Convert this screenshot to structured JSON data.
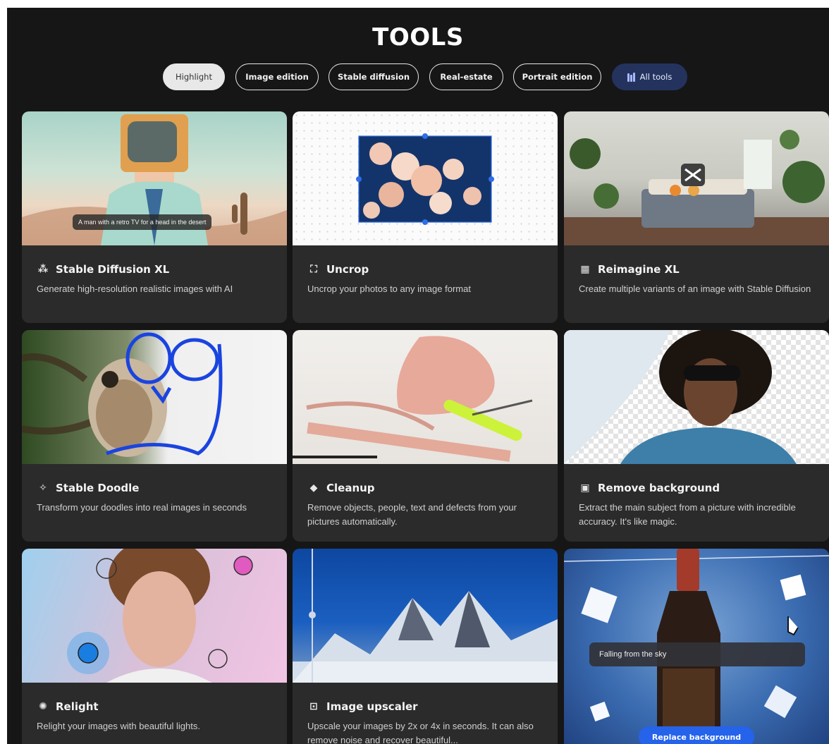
{
  "page": {
    "title": "TOOLS"
  },
  "filters": [
    {
      "label": "Highlight",
      "active": true
    },
    {
      "label": "Image edition",
      "active": false
    },
    {
      "label": "Stable diffusion",
      "active": false
    },
    {
      "label": "Real-estate",
      "active": false
    },
    {
      "label": "Portrait edition",
      "active": false
    },
    {
      "label": "All tools",
      "active": false,
      "icon": "books-icon"
    }
  ],
  "cards": [
    {
      "title": "Stable Diffusion XL",
      "description": "Generate high-resolution realistic images with AI",
      "icon": "image-sparkle-icon",
      "thumb_caption": "A man with a retro TV for a head in the desert"
    },
    {
      "title": "Uncrop",
      "description": "Uncrop your photos to any image format",
      "icon": "crop-expand-icon"
    },
    {
      "title": "Reimagine XL",
      "description": "Create multiple variants of an image with Stable Diffusion",
      "icon": "image-variants-icon"
    },
    {
      "title": "Stable Doodle",
      "description": "Transform your doodles into real images in seconds",
      "icon": "magic-wand-icon"
    },
    {
      "title": "Cleanup",
      "description": "Remove objects, people, text and defects from your pictures automatically.",
      "icon": "eraser-icon"
    },
    {
      "title": "Remove background",
      "description": "Extract the main subject from a picture with incredible accuracy. It's like magic.",
      "icon": "subject-cutout-icon"
    },
    {
      "title": "Relight",
      "description": "Relight your images with beautiful lights.",
      "icon": "light-bulb-icon"
    },
    {
      "title": "Image upscaler",
      "description": "Upscale your images by 2x or 4x in seconds. It can also remove noise and recover beautiful...",
      "icon": "upscale-frame-icon"
    },
    {
      "title": "",
      "description": "",
      "prompt_value": "Falling from the sky",
      "button_label": "Replace background"
    }
  ],
  "colors": {
    "background": "#161616",
    "card": "#2b2b2b",
    "accent": "#2563eb",
    "all_tools_pill": "#24335e"
  }
}
